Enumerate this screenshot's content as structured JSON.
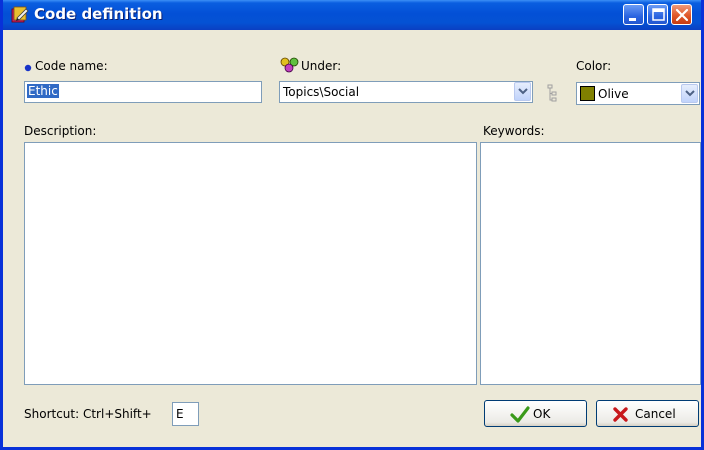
{
  "window": {
    "title": "Code definition",
    "buttons": {
      "minimize": "minimize-icon",
      "maximize": "maximize-icon",
      "close": "close-icon"
    }
  },
  "code_name": {
    "label": "Code name:",
    "value": "Ethic"
  },
  "under": {
    "label": "Under:",
    "value": "Topics\\Social"
  },
  "color": {
    "label": "Color:",
    "value": "Olive",
    "swatch": "#808000"
  },
  "description": {
    "label": "Description:",
    "value": ""
  },
  "keywords": {
    "label": "Keywords:",
    "value": ""
  },
  "shortcut": {
    "label": "Shortcut: Ctrl+Shift+",
    "value": "E"
  },
  "buttons": {
    "ok": "OK",
    "cancel": "Cancel"
  },
  "colors": {
    "titlebar": "#0a5ee0",
    "dialog_bg": "#ece9d8",
    "ok_icon": "#3a9a1a",
    "cancel_icon": "#c8181c",
    "bullet": "#1833c8"
  }
}
